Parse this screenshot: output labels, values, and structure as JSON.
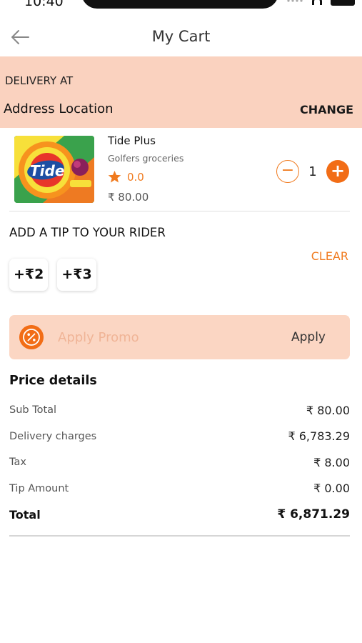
{
  "status_bar": {
    "time": "10:40"
  },
  "header": {
    "title": "My Cart"
  },
  "delivery": {
    "label": "DELIVERY AT",
    "address": "Address Location",
    "change_label": "CHANGE"
  },
  "product": {
    "name": "Tide Plus",
    "store": "Golfers groceries",
    "rating": "0.0",
    "price": "₹ 80.00",
    "quantity": "1",
    "brand_logo_text": "Tide"
  },
  "tip": {
    "title": "ADD A TIP TO YOUR RIDER",
    "clear_label": "CLEAR",
    "options": [
      "+₹2",
      "+₹3"
    ]
  },
  "promo": {
    "placeholder": "Apply Promo",
    "apply_label": "Apply"
  },
  "price_details": {
    "title": "Price details",
    "rows": [
      {
        "label": "Sub Total",
        "value": "₹ 80.00"
      },
      {
        "label": "Delivery charges",
        "value": "₹ 6,783.29"
      },
      {
        "label": "Tax",
        "value": "₹ 8.00"
      },
      {
        "label": "Tip Amount",
        "value": "₹ 0.00"
      }
    ],
    "total": {
      "label": "Total",
      "value": "₹ 6,871.29"
    }
  },
  "colors": {
    "accent": "#f26d16",
    "delivery_bg": "#fad2bf",
    "promo_bg": "#fbd6c3"
  },
  "icons": [
    "back-arrow-icon",
    "star-icon",
    "minus-icon",
    "plus-icon",
    "percent-icon"
  ]
}
